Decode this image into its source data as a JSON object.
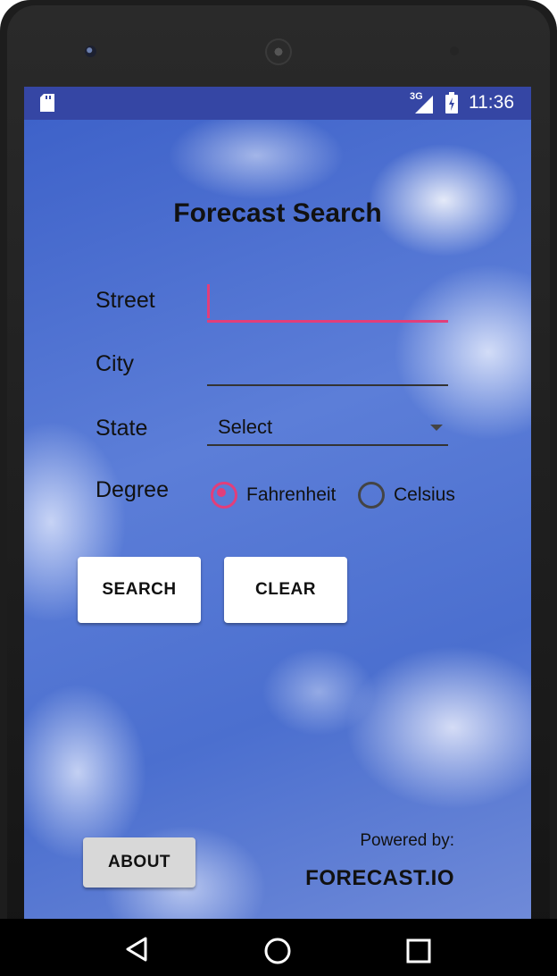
{
  "status_bar": {
    "network": "3G",
    "time": "11:36",
    "icons": [
      "sd-card-icon",
      "signal-icon",
      "battery-icon"
    ]
  },
  "page": {
    "title": "Forecast Search"
  },
  "form": {
    "street": {
      "label": "Street",
      "value": "",
      "placeholder": ""
    },
    "city": {
      "label": "City",
      "value": "",
      "placeholder": ""
    },
    "state": {
      "label": "State",
      "selected": "Select"
    },
    "degree": {
      "label": "Degree",
      "options": [
        {
          "label": "Fahrenheit",
          "selected": true
        },
        {
          "label": "Celsius",
          "selected": false
        }
      ]
    }
  },
  "buttons": {
    "search": "SEARCH",
    "clear": "CLEAR",
    "about": "ABOUT"
  },
  "footer": {
    "powered_by": "Powered by:",
    "brand": "FORECAST.IO"
  },
  "colors": {
    "accent": "#e23e7a",
    "status_bar": "#3546a4"
  }
}
